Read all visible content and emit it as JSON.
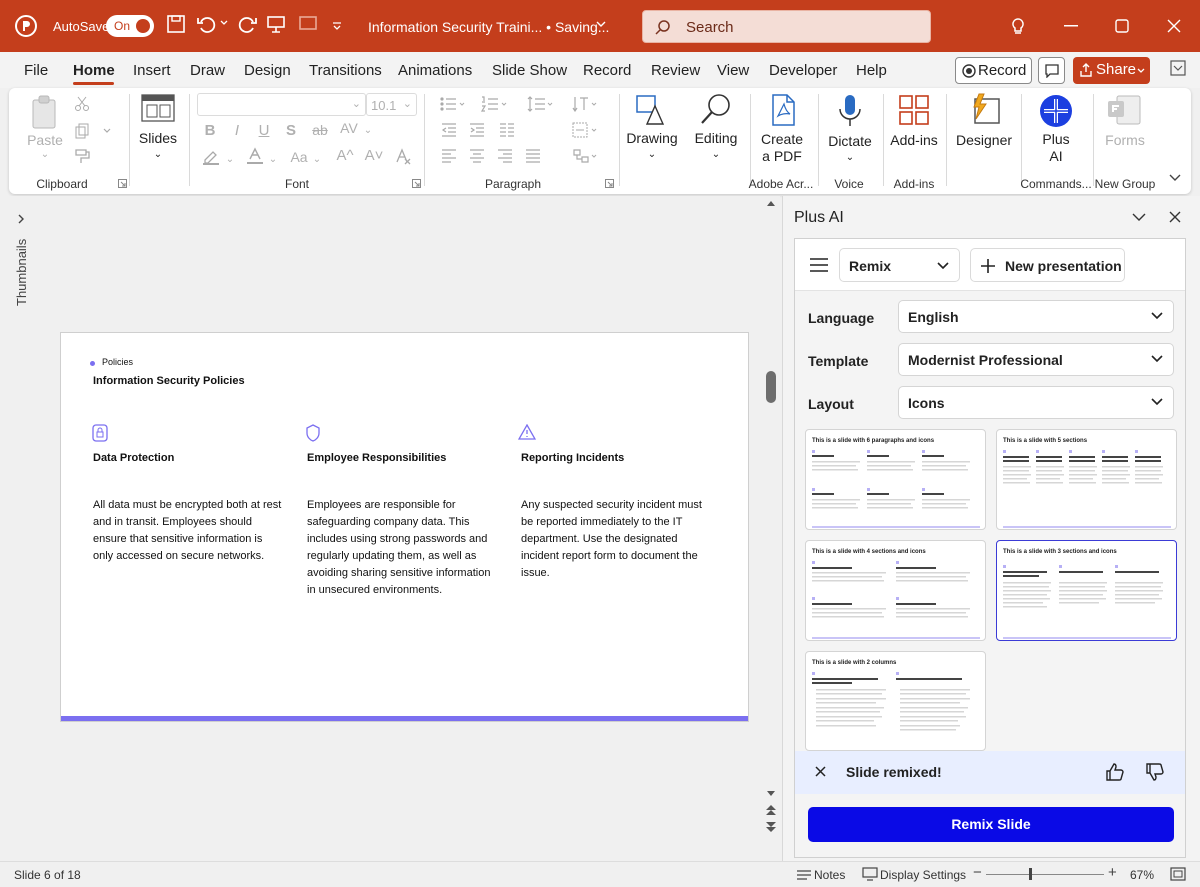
{
  "titlebar": {
    "autosave_label": "AutoSave",
    "autosave_toggle": "On",
    "doc_title": "Information Security Traini...  •  Saving...",
    "search_placeholder": "Search"
  },
  "menu": {
    "items": [
      "File",
      "Home",
      "Insert",
      "Draw",
      "Design",
      "Transitions",
      "Animations",
      "Slide Show",
      "Record",
      "Review",
      "View",
      "Developer",
      "Help"
    ],
    "active": "Home",
    "record_label": "Record",
    "share_label": "Share"
  },
  "ribbon": {
    "paste": "Paste",
    "slides": "Slides",
    "font_size": "10.1",
    "drawing": "Drawing",
    "editing": "Editing",
    "create_pdf": [
      "Create",
      "a PDF"
    ],
    "dictate": "Dictate",
    "addins": "Add-ins",
    "designer": "Designer",
    "plus_ai": [
      "Plus",
      "AI"
    ],
    "forms": "Forms",
    "groups": {
      "clipboard": "Clipboard",
      "font": "Font",
      "paragraph": "Paragraph",
      "adobe": "Adobe Acr...",
      "voice": "Voice",
      "addins": "Add-ins",
      "commands": "Commands...",
      "newgroup": "New Group"
    }
  },
  "left_strip": {
    "thumbnails_label": "Thumbnails"
  },
  "slide": {
    "section": "Policies",
    "title": "Information Security Policies",
    "accent_color": "#7b6ff0",
    "columns": [
      {
        "icon": "lock-icon",
        "heading": "Data Protection",
        "body": "All data must be encrypted both at rest and in transit. Employees should ensure that sensitive information is only accessed on secure networks."
      },
      {
        "icon": "shield-icon",
        "heading": "Employee Responsibilities",
        "body": "Employees are responsible for safeguarding company data. This includes using strong passwords and regularly updating them, as well as avoiding sharing sensitive information in unsecured environments."
      },
      {
        "icon": "warning-icon",
        "heading": "Reporting Incidents",
        "body": "Any suspected security incident must be reported immediately to the IT department. Use the designated incident report form to document the issue."
      }
    ]
  },
  "pane": {
    "title": "Plus AI",
    "mode": "Remix",
    "new_presentation": "New presentation",
    "language_label": "Language",
    "language_value": "English",
    "template_label": "Template",
    "template_value": "Modernist Professional",
    "layout_label": "Layout",
    "layout_value": "Icons",
    "thumbnails": [
      {
        "title": "This is a slide with 6 paragraphs and icons"
      },
      {
        "title": "This is a slide with 5 sections"
      },
      {
        "title": "This is a slide with 4 sections and icons"
      },
      {
        "title": "This is a slide with 3 sections and icons"
      },
      {
        "title": "This is a slide with 2 columns"
      }
    ],
    "selected_thumbnail": 3,
    "notice": "Slide remixed!",
    "remix_button": "Remix Slide",
    "remix_color": "#0a0ae6"
  },
  "status": {
    "slide_counter": "Slide 6 of 18",
    "notes": "Notes",
    "display_settings": "Display Settings",
    "zoom": "67%"
  },
  "colors": {
    "titlebar": "#c43e1c",
    "share": "#c43e1c"
  }
}
